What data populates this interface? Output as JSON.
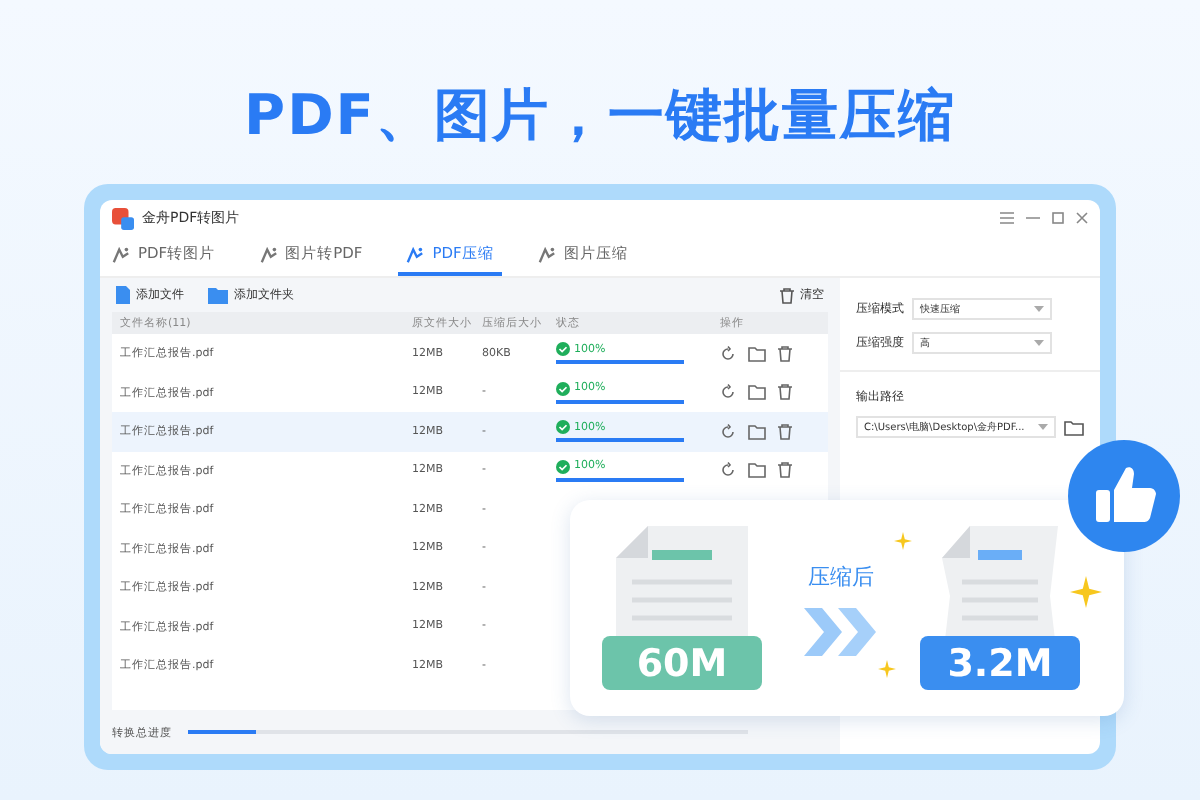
{
  "headline": "PDF、图片，一键批量压缩",
  "window": {
    "title": "金舟PDF转图片"
  },
  "tabs": [
    {
      "label": "PDF转图片",
      "selected": false
    },
    {
      "label": "图片转PDF",
      "selected": false
    },
    {
      "label": "PDF压缩",
      "selected": true
    },
    {
      "label": "图片压缩",
      "selected": false
    }
  ],
  "toolbar": {
    "add_file": "添加文件",
    "add_folder": "添加文件夹",
    "clear": "清空"
  },
  "table": {
    "columns": [
      "文件名称(11)",
      "原文件大小",
      "压缩后大小",
      "状态",
      "操作"
    ],
    "rows": [
      {
        "name": "工作汇总报告.pdf",
        "original_size": "12MB",
        "compressed_size": "80KB",
        "status": "100%",
        "level": 1,
        "selected": false
      },
      {
        "name": "工作汇总报告.pdf",
        "original_size": "12MB",
        "compressed_size": "-",
        "status": "100%",
        "level": 1,
        "selected": false
      },
      {
        "name": "工作汇总报告.pdf",
        "original_size": "12MB",
        "compressed_size": "-",
        "status": "100%",
        "level": 1,
        "selected": true
      },
      {
        "name": "工作汇总报告.pdf",
        "original_size": "12MB",
        "compressed_size": "-",
        "status": "100%",
        "level": 1,
        "selected": false
      },
      {
        "name": "工作汇总报告.pdf",
        "original_size": "12MB",
        "compressed_size": "-",
        "selected": false
      },
      {
        "name": "工作汇总报告.pdf",
        "original_size": "12MB",
        "compressed_size": "-",
        "selected": false
      },
      {
        "name": "工作汇总报告.pdf",
        "original_size": "12MB",
        "compressed_size": "-",
        "selected": false
      },
      {
        "name": "工作汇总报告.pdf",
        "original_size": "12MB",
        "compressed_size": "-",
        "selected": false
      },
      {
        "name": "工作汇总报告.pdf",
        "original_size": "12MB",
        "compressed_size": "-",
        "selected": false
      }
    ]
  },
  "settings": {
    "mode_label": "压缩模式",
    "mode": "快速压缩",
    "strength_label": "压缩强度",
    "strength": "高",
    "output_label": "输出路径",
    "output_path": "C:\\Users\\电脑\\Desktop\\金舟PDF..."
  },
  "progress": {
    "label": "转换总进度",
    "level": 0.12
  },
  "comparison": {
    "before": "60M",
    "after_label": "压缩后",
    "after": "3.2M"
  }
}
